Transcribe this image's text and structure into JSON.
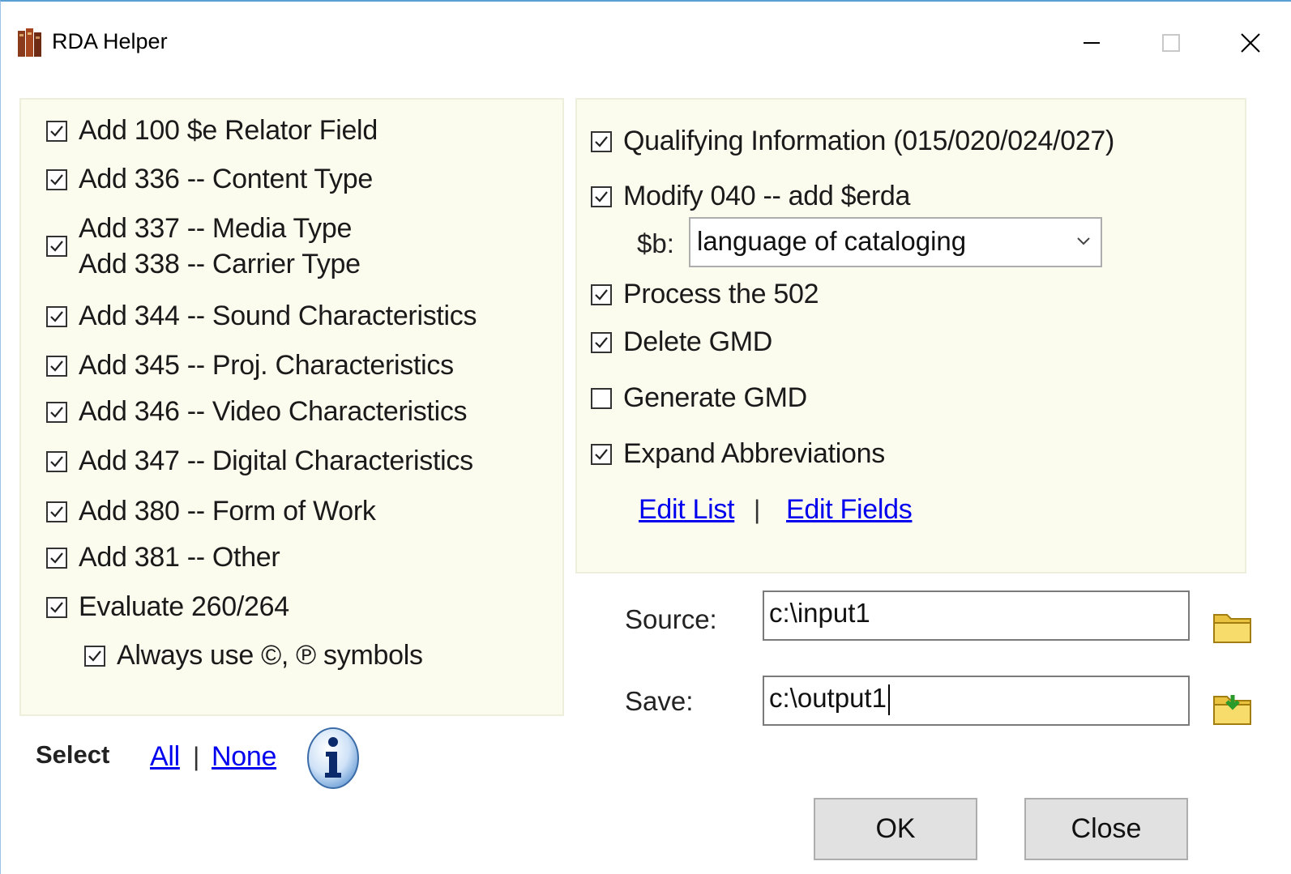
{
  "window": {
    "title": "RDA Helper",
    "minimize_icon": "minimize-icon",
    "maximize_icon": "maximize-icon",
    "close_icon": "close-icon"
  },
  "left_panel": {
    "items": [
      {
        "label": "Add 100 $e Relator Field",
        "checked": true
      },
      {
        "label": "Add 336 -- Content Type",
        "checked": true
      },
      {
        "label": "Add 337 -- Media Type",
        "label2": "Add 338 -- Carrier Type",
        "checked": true
      },
      {
        "label": "Add 344 -- Sound Characteristics",
        "checked": true
      },
      {
        "label": "Add 345 -- Proj. Characteristics",
        "checked": true
      },
      {
        "label": "Add 346 -- Video Characteristics",
        "checked": true
      },
      {
        "label": "Add 347 -- Digital Characteristics",
        "checked": true
      },
      {
        "label": "Add 380 -- Form of Work",
        "checked": true
      },
      {
        "label": "Add 381 -- Other",
        "checked": true
      },
      {
        "label": "Evaluate 260/264",
        "checked": true
      },
      {
        "label": "Always use ©, ℗ symbols",
        "checked": true
      }
    ]
  },
  "right_panel": {
    "items": [
      {
        "label": "Qualifying Information (015/020/024/027)",
        "checked": true
      },
      {
        "label": "Modify 040 -- add $erda",
        "checked": true
      },
      {
        "label": "Process the 502",
        "checked": true
      },
      {
        "label": "Delete GMD",
        "checked": true
      },
      {
        "label": "Generate GMD",
        "checked": false
      },
      {
        "label": "Expand Abbreviations",
        "checked": true
      }
    ],
    "sb_label": "$b:",
    "sb_value": "language of cataloging",
    "edit_list": "Edit List",
    "link_separator": "|",
    "edit_fields": "Edit Fields"
  },
  "source": {
    "label": "Source:",
    "value": "c:\\input1",
    "icon": "folder-icon"
  },
  "save": {
    "label": "Save:",
    "value": "c:\\output1",
    "icon": "folder-save-icon"
  },
  "select": {
    "label": "Select",
    "all": "All",
    "separator": "|",
    "none": "None",
    "info_icon": "info-icon"
  },
  "buttons": {
    "ok": "OK",
    "close": "Close"
  },
  "colors": {
    "panel_bg": "#fbfbee",
    "link": "#0000ee",
    "button_bg": "#e1e1e1"
  }
}
